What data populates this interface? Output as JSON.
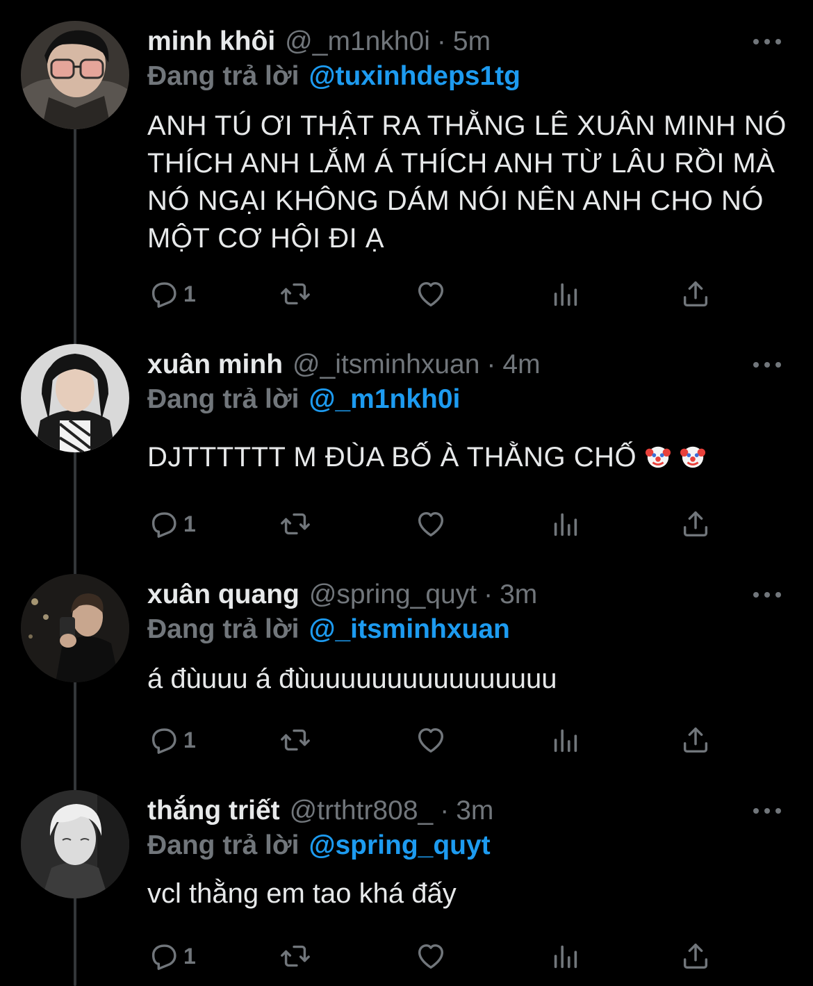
{
  "theme": {
    "background": "#000000",
    "text": "#e7e9ea",
    "muted": "#71767b",
    "link": "#1d9bf0"
  },
  "tweets": [
    {
      "name": "minh khôi",
      "handle": "@_m1nkh0i",
      "separator": "·",
      "time": "5m",
      "reply_label": "Đang trả lời",
      "reply_handle": "@tuxinhdeps1tg",
      "text": "ANH TÚ ƠI THẬT RA THẰNG LÊ XUÂN MINH NÓ THÍCH ANH LẮM Á THÍCH ANH TỪ LÂU RỒI MÀ NÓ NGẠI KHÔNG DÁM NÓI NÊN ANH CHO NÓ MỘT CƠ HỘI ĐI Ạ",
      "reply_count": "1"
    },
    {
      "name": "xuân minh",
      "handle": "@_itsminhxuan",
      "separator": "·",
      "time": "4m",
      "reply_label": "Đang trả lời",
      "reply_handle": "@_m1nkh0i",
      "text": "DJTTTTTT M ĐÙA BỐ À THẰNG CHỐ",
      "emoji": [
        "clown-face-icon",
        "clown-face-icon"
      ],
      "reply_count": "1"
    },
    {
      "name": "xuân quang",
      "handle": "@spring_quyt",
      "separator": "·",
      "time": "3m",
      "reply_label": "Đang trả lời",
      "reply_handle": "@_itsminhxuan",
      "text": "á đùuuu á đùuuuuuuuuuuuuuuuu",
      "reply_count": "1"
    },
    {
      "name": "thắng triết",
      "handle": "@trthtr808_",
      "separator": "·",
      "time": "3m",
      "reply_label": "Đang trả lời",
      "reply_handle": "@spring_quyt",
      "text": "vcl thằng em tao khá đấy",
      "reply_count": "1"
    }
  ],
  "icons": {
    "reply": "reply-icon",
    "retweet": "retweet-icon",
    "like": "heart-icon",
    "views": "analytics-icon",
    "share": "share-icon",
    "more": "more-icon"
  }
}
